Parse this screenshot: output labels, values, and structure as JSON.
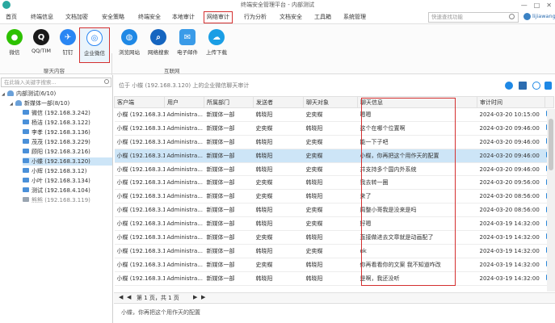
{
  "window": {
    "title": "终端安全管理平台 - 内部测试",
    "controls": [
      "—",
      "□",
      "✕"
    ]
  },
  "menu": {
    "items": [
      "首页",
      "终端信息",
      "文档加密",
      "安全策略",
      "终端安全",
      "本地审计",
      "网络审计",
      "行为分析",
      "文档安全",
      "工具箱",
      "系统管理"
    ],
    "active_index": 6,
    "search_placeholder": "快速查找功能",
    "user": "lijiawang"
  },
  "toolbar": {
    "chat_tools": [
      "微信",
      "QQ/TIM",
      "钉钉",
      "企业微信"
    ],
    "internet_tools": [
      "浏览网站",
      "网络搜索",
      "电子邮件",
      "上传下载"
    ],
    "active_tool": "企业微信",
    "group_chat": "聊天内容",
    "group_internet": "互联网"
  },
  "tree": {
    "search_placeholder": "在此输入关键字搜索...",
    "root": "内部测试(6/10)",
    "group": "新媒体一部(8/10)",
    "computers": [
      {
        "label": "微信 (192.168.3.242)",
        "online": true
      },
      {
        "label": "杨洁 (192.168.3.122)",
        "online": true
      },
      {
        "label": "李孝 (192.168.3.136)",
        "online": true
      },
      {
        "label": "茂茂 (192.168.3.229)",
        "online": true
      },
      {
        "label": "顾阳 (192.168.3.216)",
        "online": true
      },
      {
        "label": "小蝶 (192.168.3.120)",
        "online": true,
        "selected": true
      },
      {
        "label": "小辉 (192.168.3.12)",
        "online": true
      },
      {
        "label": "小叶 (192.168.3.134)",
        "online": true
      },
      {
        "label": "测试 (192.168.4.104)",
        "online": true
      },
      {
        "label": "熊熊 (192.168.3.119)",
        "online": false
      }
    ]
  },
  "main": {
    "info": "位于 小蝶 (192.168.3.120) 上的企业微信聊天审计",
    "columns": [
      "客户端",
      "用户",
      "所属部门",
      "发送者",
      "聊天对象",
      "聊天信息",
      "审计时间"
    ],
    "rows": [
      [
        "小蝶 (192.168.3.120)",
        "Administra...",
        "新媒体一部",
        "韩晓阳",
        "史奕蝶",
        "嗯嗯",
        "2024-03-20 10:15:00"
      ],
      [
        "小蝶 (192.168.3.120)",
        "Administra...",
        "新媒体一部",
        "史奕蝶",
        "韩晓阳",
        "这个在哪个位置啊",
        "2024-03-20 09:46:00"
      ],
      [
        "小蝶 (192.168.3.120)",
        "Administra...",
        "新媒体一部",
        "韩晓阳",
        "史奕蝶",
        "能一下子吧",
        "2024-03-20 09:46:00"
      ],
      [
        "小蝶 (192.168.3.120)",
        "Administra...",
        "新媒体一部",
        "韩晓阳",
        "史奕蝶",
        "小蝶，你再把这个用作天的配置",
        "2024-03-20 09:46:00"
      ],
      [
        "小蝶 (192.168.3.120)",
        "Administra...",
        "新媒体一部",
        "韩晓阳",
        "史奕蝶",
        "并支持多个国内外系统",
        "2024-03-20 09:46:00"
      ],
      [
        "小蝶 (192.168.3.120)",
        "Administra...",
        "新媒体一部",
        "史奕蝶",
        "韩晓阳",
        "我去转一圈",
        "2024-03-20 09:56:00"
      ],
      [
        "小蝶 (192.168.3.120)",
        "Administra...",
        "新媒体一部",
        "史奕蝶",
        "韩晓阳",
        "来了",
        "2024-03-20 08:56:00"
      ],
      [
        "小蝶 (192.168.3.120)",
        "Administra...",
        "新媒体一部",
        "韩晓阳",
        "史奕蝶",
        "周整小哥我是没来是吗",
        "2024-03-20 08:56:00"
      ],
      [
        "小蝶 (192.168.3.120)",
        "Administra...",
        "新媒体一部",
        "韩晓阳",
        "史奕蝶",
        "好嗯",
        "2024-03-19 14:32:00"
      ],
      [
        "小蝶 (192.168.3.120)",
        "Administra...",
        "新媒体一部",
        "史奕蝶",
        "韩晓阳",
        "直接做进去文章就是动画配了",
        "2024-03-19 14:32:00"
      ],
      [
        "小蝶 (192.168.3.120)",
        "Administra...",
        "新媒体一部",
        "韩晓阳",
        "史奕蝶",
        "ok",
        "2024-03-19 14:32:00"
      ],
      [
        "小蝶 (192.168.3.120)",
        "Administra...",
        "新媒体一部",
        "史奕蝶",
        "韩晓阳",
        "你再看看你的文案 我不知道咋改",
        "2024-03-19 14:32:00"
      ],
      [
        "小蝶 (192.168.3.120)",
        "Administra...",
        "新媒体一部",
        "韩晓阳",
        "韩晓阳",
        "是啊，我还没听",
        "2024-03-19 14:32:00"
      ]
    ],
    "selected_row": 3
  },
  "pager": {
    "first": "◀",
    "prev": "◀",
    "text": "第 1 页，共 1 页",
    "next": "▶",
    "last": "▶"
  },
  "preview": {
    "text": "小蝶，你再把这个用作天的配置"
  }
}
